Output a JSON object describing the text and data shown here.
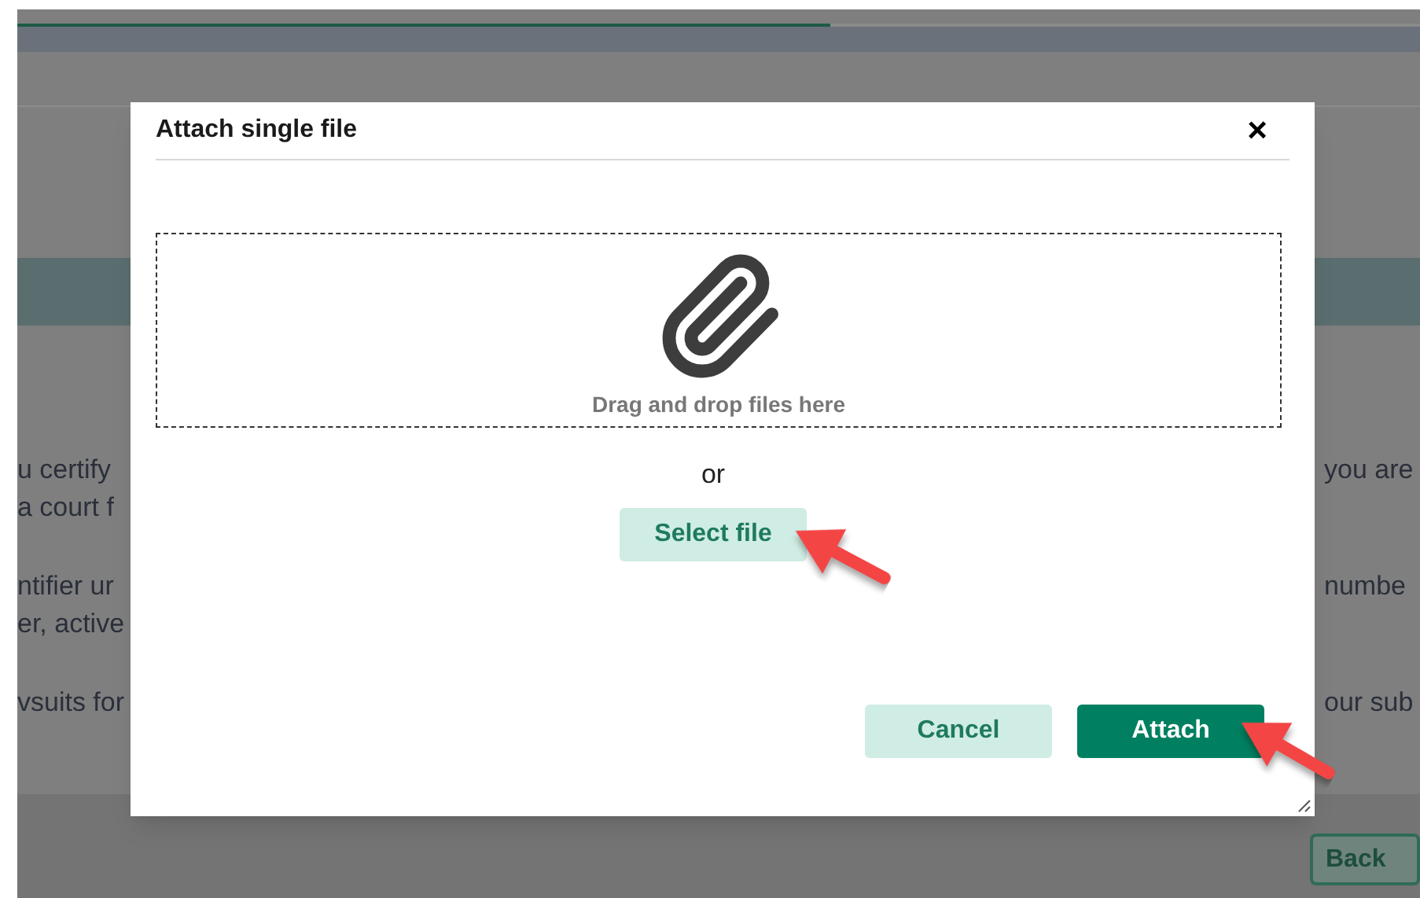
{
  "progress": {
    "level": 0.58
  },
  "background": {
    "paragraphs": [
      {
        "left": [
          "u certify",
          "a court f"
        ],
        "right": [
          "you are"
        ]
      },
      {
        "left": [
          "ntifier ur",
          "er, active"
        ],
        "right": [
          "numbe"
        ]
      },
      {
        "left": [
          "vsuits for"
        ],
        "right": [
          "our sub"
        ]
      }
    ],
    "back_button": "Back"
  },
  "dialog": {
    "title": "Attach single file",
    "close": "×",
    "drop_zone": "Drag and drop files here",
    "or": "or",
    "select_button": "Select file",
    "buttons": [
      {
        "label": "Cancel",
        "kind": "secondary"
      },
      {
        "label": "Attach",
        "kind": "primary"
      }
    ]
  }
}
